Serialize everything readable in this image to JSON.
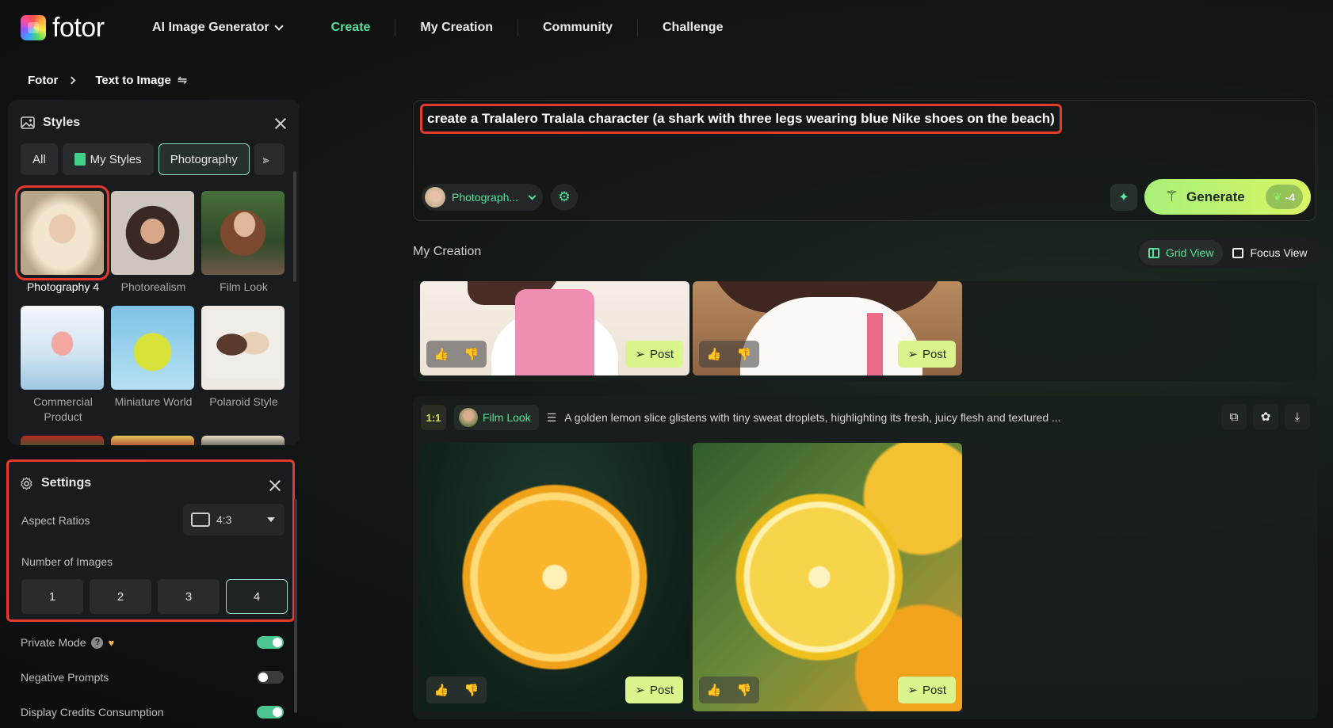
{
  "brand": {
    "name": "fotor"
  },
  "nav": {
    "items": [
      {
        "label": "AI Image Generator",
        "dropdown": true,
        "active": false
      },
      {
        "label": "Create",
        "active": true
      },
      {
        "label": "My Creation",
        "active": false
      },
      {
        "label": "Community",
        "active": false
      },
      {
        "label": "Challenge",
        "active": false
      }
    ]
  },
  "breadcrumb": {
    "root": "Fotor",
    "current": "Text to Image"
  },
  "styles_panel": {
    "title": "Styles",
    "chips": [
      {
        "label": "All",
        "selected": false
      },
      {
        "label": "My Styles",
        "selected": false
      },
      {
        "label": "Photography",
        "selected": true
      }
    ],
    "items": [
      {
        "name": "Photography 4",
        "selected": true
      },
      {
        "name": "Photorealism",
        "selected": false
      },
      {
        "name": "Film Look",
        "selected": false
      },
      {
        "name": "Commercial Product",
        "selected": false
      },
      {
        "name": "Miniature World",
        "selected": false
      },
      {
        "name": "Polaroid Style",
        "selected": false
      }
    ]
  },
  "settings": {
    "title": "Settings",
    "aspect_label": "Aspect Ratios",
    "aspect_value": "4:3",
    "count_label": "Number of Images",
    "count_options": [
      "1",
      "2",
      "3",
      "4"
    ],
    "count_selected": "4"
  },
  "toggles": [
    {
      "label": "Private Mode",
      "on": true
    },
    {
      "label": "Negative Prompts",
      "on": false
    },
    {
      "label": "Display Credits Consumption",
      "on": true
    }
  ],
  "prompt": {
    "text": "create a Tralalero Tralala character (a shark with three legs wearing blue Nike shoes on the beach)",
    "style_pill": "Photograph...",
    "generate_label": "Generate",
    "credits": "-4"
  },
  "creation": {
    "title": "My Creation",
    "grid_view_label": "Grid View",
    "focus_view_label": "Focus View",
    "post_label": "Post",
    "card2": {
      "ratio": "1:1",
      "style": "Film Look",
      "prompt": "A golden lemon slice glistens with tiny sweat droplets, highlighting its fresh, juicy flesh and textured ..."
    }
  },
  "colors": {
    "accent": "#57e0a0",
    "highlight": "#e53a2e",
    "generate": "#d9f564"
  }
}
